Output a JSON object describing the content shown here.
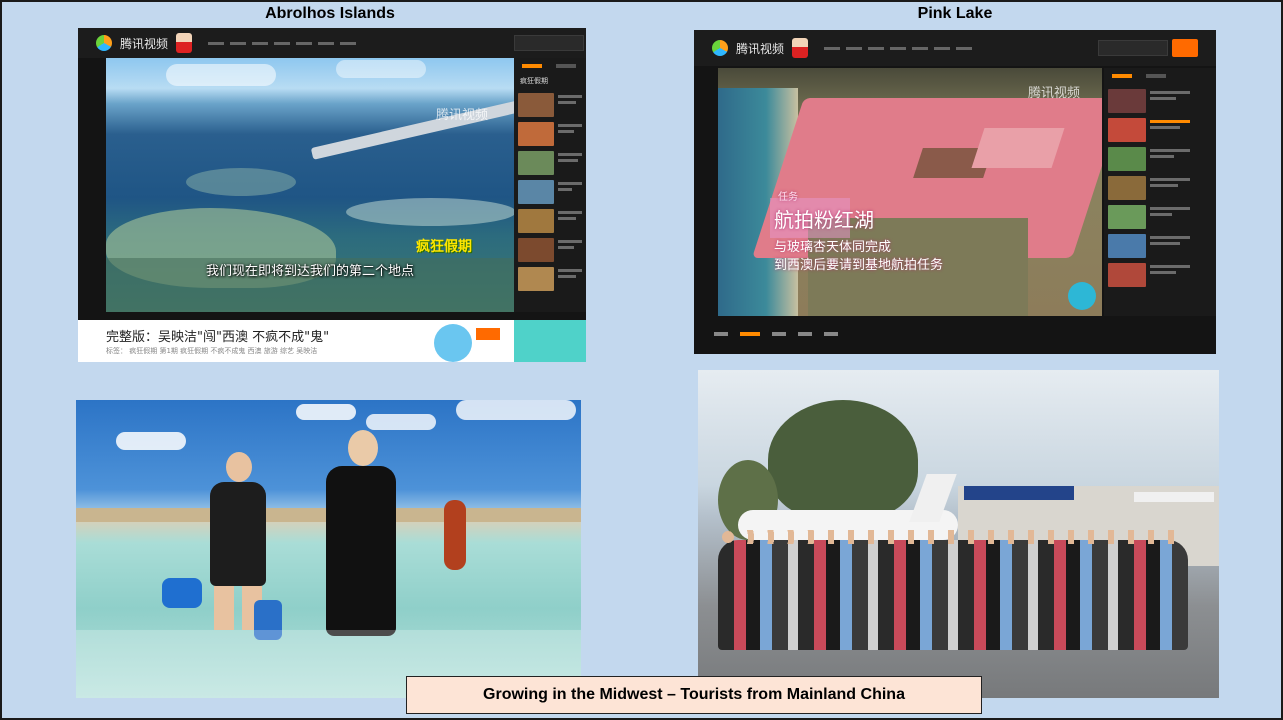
{
  "slide": {
    "heading_left": "Abrolhos Islands",
    "heading_right": "Pink Lake",
    "caption": "Growing in the Midwest – Tourists from Mainland China"
  },
  "player_left": {
    "logo_text": "腾讯视频",
    "watermark": "腾讯视频",
    "subtitle": "我们现在即将到达我们的第二个地点",
    "show_badge": "疯狂假期",
    "info_title": "完整版：吴映洁\"闯\"西澳 不疯不成\"鬼\"",
    "info_meta": "标签：  疯狂假期  第1期  疯狂假期  不疯不成鬼  西澳  旅游  综艺  吴映洁",
    "side_label": "疯狂假期"
  },
  "player_right": {
    "logo_text": "腾讯视频",
    "watermark": "腾讯视频",
    "overlay_title": "航拍粉红湖",
    "overlay_tag": "任务",
    "overlay_line1": "与玻璃杏天体同完成",
    "overlay_line2": "到西澳后要请到基地航拍任务"
  },
  "colors": {
    "slide_bg": "#c3d8ee",
    "caption_bg": "#fde4d6",
    "accent": "#ff8a00"
  }
}
